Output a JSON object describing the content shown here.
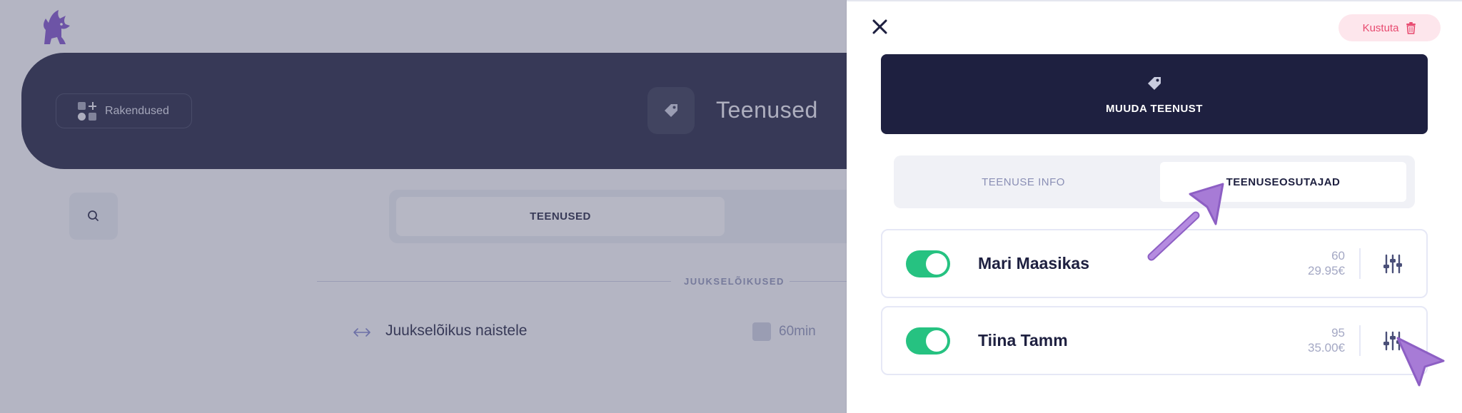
{
  "background": {
    "apps_label": "Rakendused",
    "hero_title": "Teenused",
    "segment_active": "TEENUSED",
    "section_label": "JUUKSELÕIKUSED",
    "service": {
      "name": "Juukselõikus naistele",
      "duration": "60min"
    }
  },
  "drawer": {
    "delete_label": "Kustuta",
    "edit_title": "MUUDA TEENUST",
    "tabs": {
      "info": "TEENUSE INFO",
      "providers": "TEENUSEOSUTAJAD"
    },
    "providers": [
      {
        "name": "Mari Maasikas",
        "duration": "60",
        "price": "29.95€",
        "enabled": true
      },
      {
        "name": "Tiina Tamm",
        "duration": "95",
        "price": "35.00€",
        "enabled": true
      }
    ]
  },
  "colors": {
    "navy": "#1e2040",
    "toggle_on": "#26c281",
    "delete": "#e84b70",
    "brand": "#7b4fc9",
    "cursor": "#a77bd6"
  },
  "icons": [
    "logo-icon",
    "apps-icon",
    "tag-icon",
    "search-icon",
    "move-icon",
    "clock-icon",
    "close-icon",
    "trash-icon",
    "sliders-icon",
    "cursor-icon"
  ]
}
